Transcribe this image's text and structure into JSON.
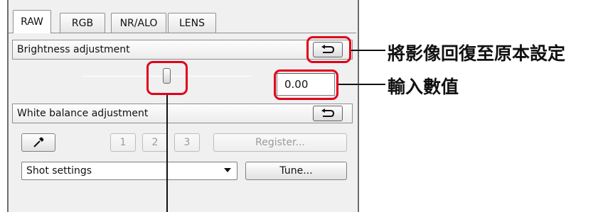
{
  "tabs": [
    {
      "label": "RAW",
      "active": true
    },
    {
      "label": "RGB",
      "active": false
    },
    {
      "label": "NR/ALO",
      "active": false
    },
    {
      "label": "LENS",
      "active": false
    }
  ],
  "brightness": {
    "title": "Brightness adjustment",
    "value": "0.00",
    "slider_level": 0.5
  },
  "white_balance": {
    "title": "White balance adjustment",
    "presets": [
      "1",
      "2",
      "3"
    ],
    "register_label": "Register...",
    "select_value": "Shot settings",
    "tune_label": "Tune..."
  },
  "callouts": {
    "reset": "將影像回復至原本設定",
    "enter_value": "輸入數值"
  },
  "colors": {
    "highlight": "#e2001a",
    "panel_bg": "#f0f0f0"
  },
  "icons": [
    "reset-arrow-icon",
    "eyedropper-icon",
    "dropdown-arrow-icon"
  ]
}
